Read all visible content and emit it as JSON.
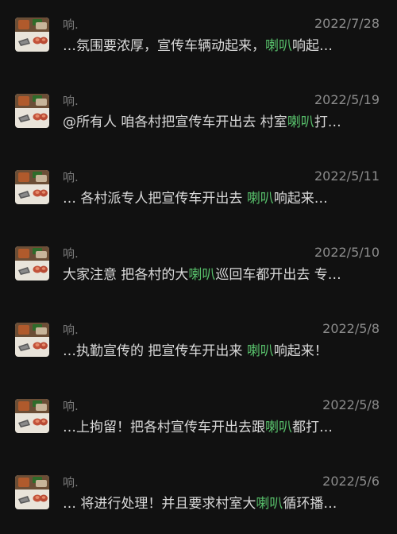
{
  "results": [
    {
      "sender": "响.",
      "date": "2022/7/28",
      "snippet_before": "…氛围要浓厚，宣传车辆动起来，",
      "highlight": "喇叭",
      "snippet_after": "响起…"
    },
    {
      "sender": "响.",
      "date": "2022/5/19",
      "snippet_before": "@所有人 咱各村把宣传车开出去 村室",
      "highlight": "喇叭",
      "snippet_after": "打…"
    },
    {
      "sender": "响.",
      "date": "2022/5/11",
      "snippet_before": "… 各村派专人把宣传车开出去 ",
      "highlight": "喇叭",
      "snippet_after": "响起来…"
    },
    {
      "sender": "响.",
      "date": "2022/5/10",
      "snippet_before": "大家注意 把各村的大",
      "highlight": "喇叭",
      "snippet_after": "巡回车都开出去 专…"
    },
    {
      "sender": "响.",
      "date": "2022/5/8",
      "snippet_before": "…执勤宣传的 把宣传车开出来 ",
      "highlight": "喇叭",
      "snippet_after": "响起来！"
    },
    {
      "sender": "响.",
      "date": "2022/5/8",
      "snippet_before": "…上拘留！把各村宣传车开出去跟",
      "highlight": "喇叭",
      "snippet_after": "都打…"
    },
    {
      "sender": "响.",
      "date": "2022/5/6",
      "snippet_before": "… 将进行处理！并且要求村室大",
      "highlight": "喇叭",
      "snippet_after": "循环播…"
    }
  ],
  "colors": {
    "background": "#111111",
    "highlight": "#57be6a",
    "snippet_text": "#d9d9d9",
    "meta_text": "#8c8c8c"
  }
}
